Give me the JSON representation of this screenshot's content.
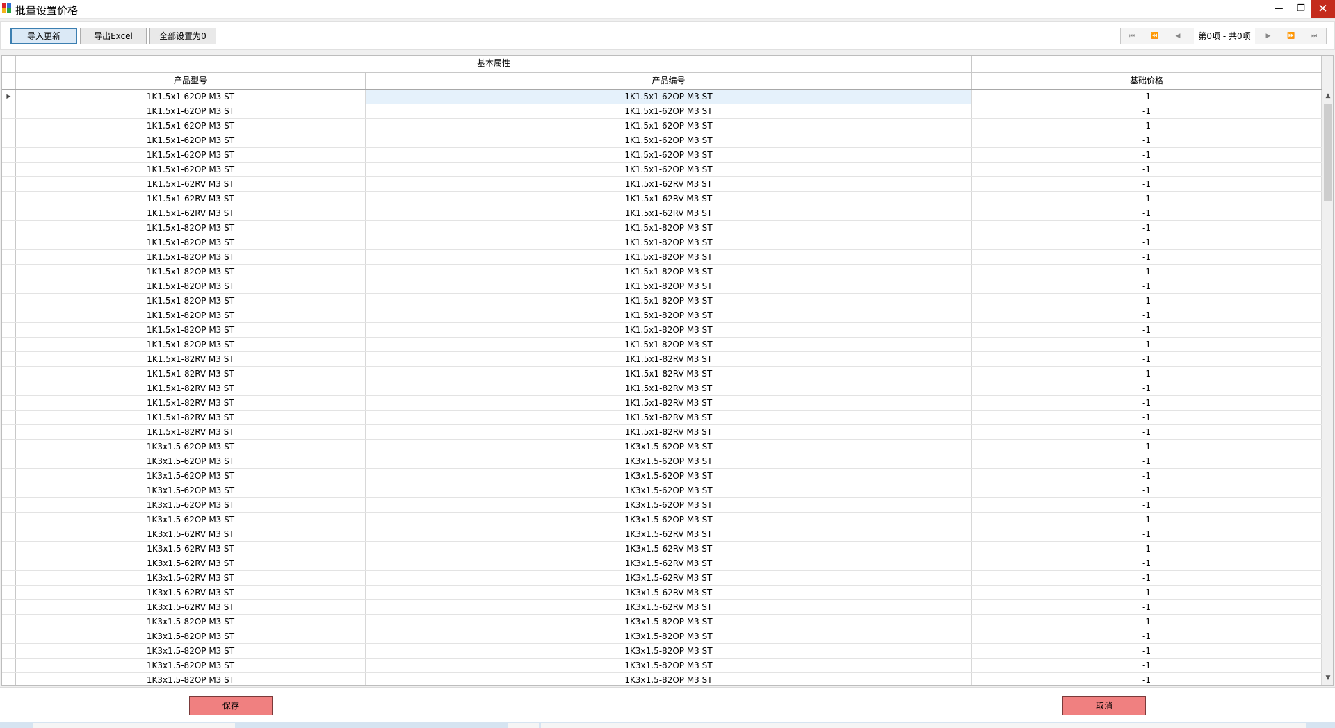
{
  "window": {
    "title": "批量设置价格",
    "minimize_icon": "minimize-icon",
    "maximize_icon": "restore-icon",
    "close_icon": "close-icon",
    "icon_colors": [
      "#d9242b",
      "#2f6fd1",
      "#f2b21a",
      "#27a344"
    ]
  },
  "toolbar": {
    "import_label": "导入更新",
    "export_label": "导出Excel",
    "zero_label": "全部设置为0"
  },
  "pager": {
    "first_glyph": "⏮",
    "prev_page_glyph": "⏪",
    "prev_glyph": "◀",
    "info": "第0项 - 共0项",
    "next_glyph": "▶",
    "next_page_glyph": "⏩",
    "last_glyph": "⏭"
  },
  "grid": {
    "band_header": "基本属性",
    "band_header_right": "",
    "columns": [
      "产品型号",
      "产品编号",
      "基础价格"
    ],
    "row_indicator": "▶",
    "rows": [
      [
        "1K1.5x1-62OP M3 ST",
        "1K1.5x1-62OP M3 ST",
        "-1"
      ],
      [
        "1K1.5x1-62OP M3 ST",
        "1K1.5x1-62OP M3 ST",
        "-1"
      ],
      [
        "1K1.5x1-62OP M3 ST",
        "1K1.5x1-62OP M3 ST",
        "-1"
      ],
      [
        "1K1.5x1-62OP M3 ST",
        "1K1.5x1-62OP M3 ST",
        "-1"
      ],
      [
        "1K1.5x1-62OP M3 ST",
        "1K1.5x1-62OP M3 ST",
        "-1"
      ],
      [
        "1K1.5x1-62OP M3 ST",
        "1K1.5x1-62OP M3 ST",
        "-1"
      ],
      [
        "1K1.5x1-62RV M3 ST",
        "1K1.5x1-62RV M3 ST",
        "-1"
      ],
      [
        "1K1.5x1-62RV M3 ST",
        "1K1.5x1-62RV M3 ST",
        "-1"
      ],
      [
        "1K1.5x1-62RV M3 ST",
        "1K1.5x1-62RV M3 ST",
        "-1"
      ],
      [
        "1K1.5x1-82OP M3 ST",
        "1K1.5x1-82OP M3 ST",
        "-1"
      ],
      [
        "1K1.5x1-82OP M3 ST",
        "1K1.5x1-82OP M3 ST",
        "-1"
      ],
      [
        "1K1.5x1-82OP M3 ST",
        "1K1.5x1-82OP M3 ST",
        "-1"
      ],
      [
        "1K1.5x1-82OP M3 ST",
        "1K1.5x1-82OP M3 ST",
        "-1"
      ],
      [
        "1K1.5x1-82OP M3 ST",
        "1K1.5x1-82OP M3 ST",
        "-1"
      ],
      [
        "1K1.5x1-82OP M3 ST",
        "1K1.5x1-82OP M3 ST",
        "-1"
      ],
      [
        "1K1.5x1-82OP M3 ST",
        "1K1.5x1-82OP M3 ST",
        "-1"
      ],
      [
        "1K1.5x1-82OP M3 ST",
        "1K1.5x1-82OP M3 ST",
        "-1"
      ],
      [
        "1K1.5x1-82OP M3 ST",
        "1K1.5x1-82OP M3 ST",
        "-1"
      ],
      [
        "1K1.5x1-82RV M3 ST",
        "1K1.5x1-82RV M3 ST",
        "-1"
      ],
      [
        "1K1.5x1-82RV M3 ST",
        "1K1.5x1-82RV M3 ST",
        "-1"
      ],
      [
        "1K1.5x1-82RV M3 ST",
        "1K1.5x1-82RV M3 ST",
        "-1"
      ],
      [
        "1K1.5x1-82RV M3 ST",
        "1K1.5x1-82RV M3 ST",
        "-1"
      ],
      [
        "1K1.5x1-82RV M3 ST",
        "1K1.5x1-82RV M3 ST",
        "-1"
      ],
      [
        "1K1.5x1-82RV M3 ST",
        "1K1.5x1-82RV M3 ST",
        "-1"
      ],
      [
        "1K3x1.5-62OP M3 ST",
        "1K3x1.5-62OP M3 ST",
        "-1"
      ],
      [
        "1K3x1.5-62OP M3 ST",
        "1K3x1.5-62OP M3 ST",
        "-1"
      ],
      [
        "1K3x1.5-62OP M3 ST",
        "1K3x1.5-62OP M3 ST",
        "-1"
      ],
      [
        "1K3x1.5-62OP M3 ST",
        "1K3x1.5-62OP M3 ST",
        "-1"
      ],
      [
        "1K3x1.5-62OP M3 ST",
        "1K3x1.5-62OP M3 ST",
        "-1"
      ],
      [
        "1K3x1.5-62OP M3 ST",
        "1K3x1.5-62OP M3 ST",
        "-1"
      ],
      [
        "1K3x1.5-62RV M3 ST",
        "1K3x1.5-62RV M3 ST",
        "-1"
      ],
      [
        "1K3x1.5-62RV M3 ST",
        "1K3x1.5-62RV M3 ST",
        "-1"
      ],
      [
        "1K3x1.5-62RV M3 ST",
        "1K3x1.5-62RV M3 ST",
        "-1"
      ],
      [
        "1K3x1.5-62RV M3 ST",
        "1K3x1.5-62RV M3 ST",
        "-1"
      ],
      [
        "1K3x1.5-62RV M3 ST",
        "1K3x1.5-62RV M3 ST",
        "-1"
      ],
      [
        "1K3x1.5-62RV M3 ST",
        "1K3x1.5-62RV M3 ST",
        "-1"
      ],
      [
        "1K3x1.5-82OP M3 ST",
        "1K3x1.5-82OP M3 ST",
        "-1"
      ],
      [
        "1K3x1.5-82OP M3 ST",
        "1K3x1.5-82OP M3 ST",
        "-1"
      ],
      [
        "1K3x1.5-82OP M3 ST",
        "1K3x1.5-82OP M3 ST",
        "-1"
      ],
      [
        "1K3x1.5-82OP M3 ST",
        "1K3x1.5-82OP M3 ST",
        "-1"
      ],
      [
        "1K3x1.5-82OP M3 ST",
        "1K3x1.5-82OP M3 ST",
        "-1"
      ]
    ],
    "selected_row": 0,
    "scroll_up_glyph": "▲",
    "scroll_down_glyph": "▼"
  },
  "footer": {
    "save_label": "保存",
    "cancel_label": "取消",
    "button_color": "#f08080"
  }
}
